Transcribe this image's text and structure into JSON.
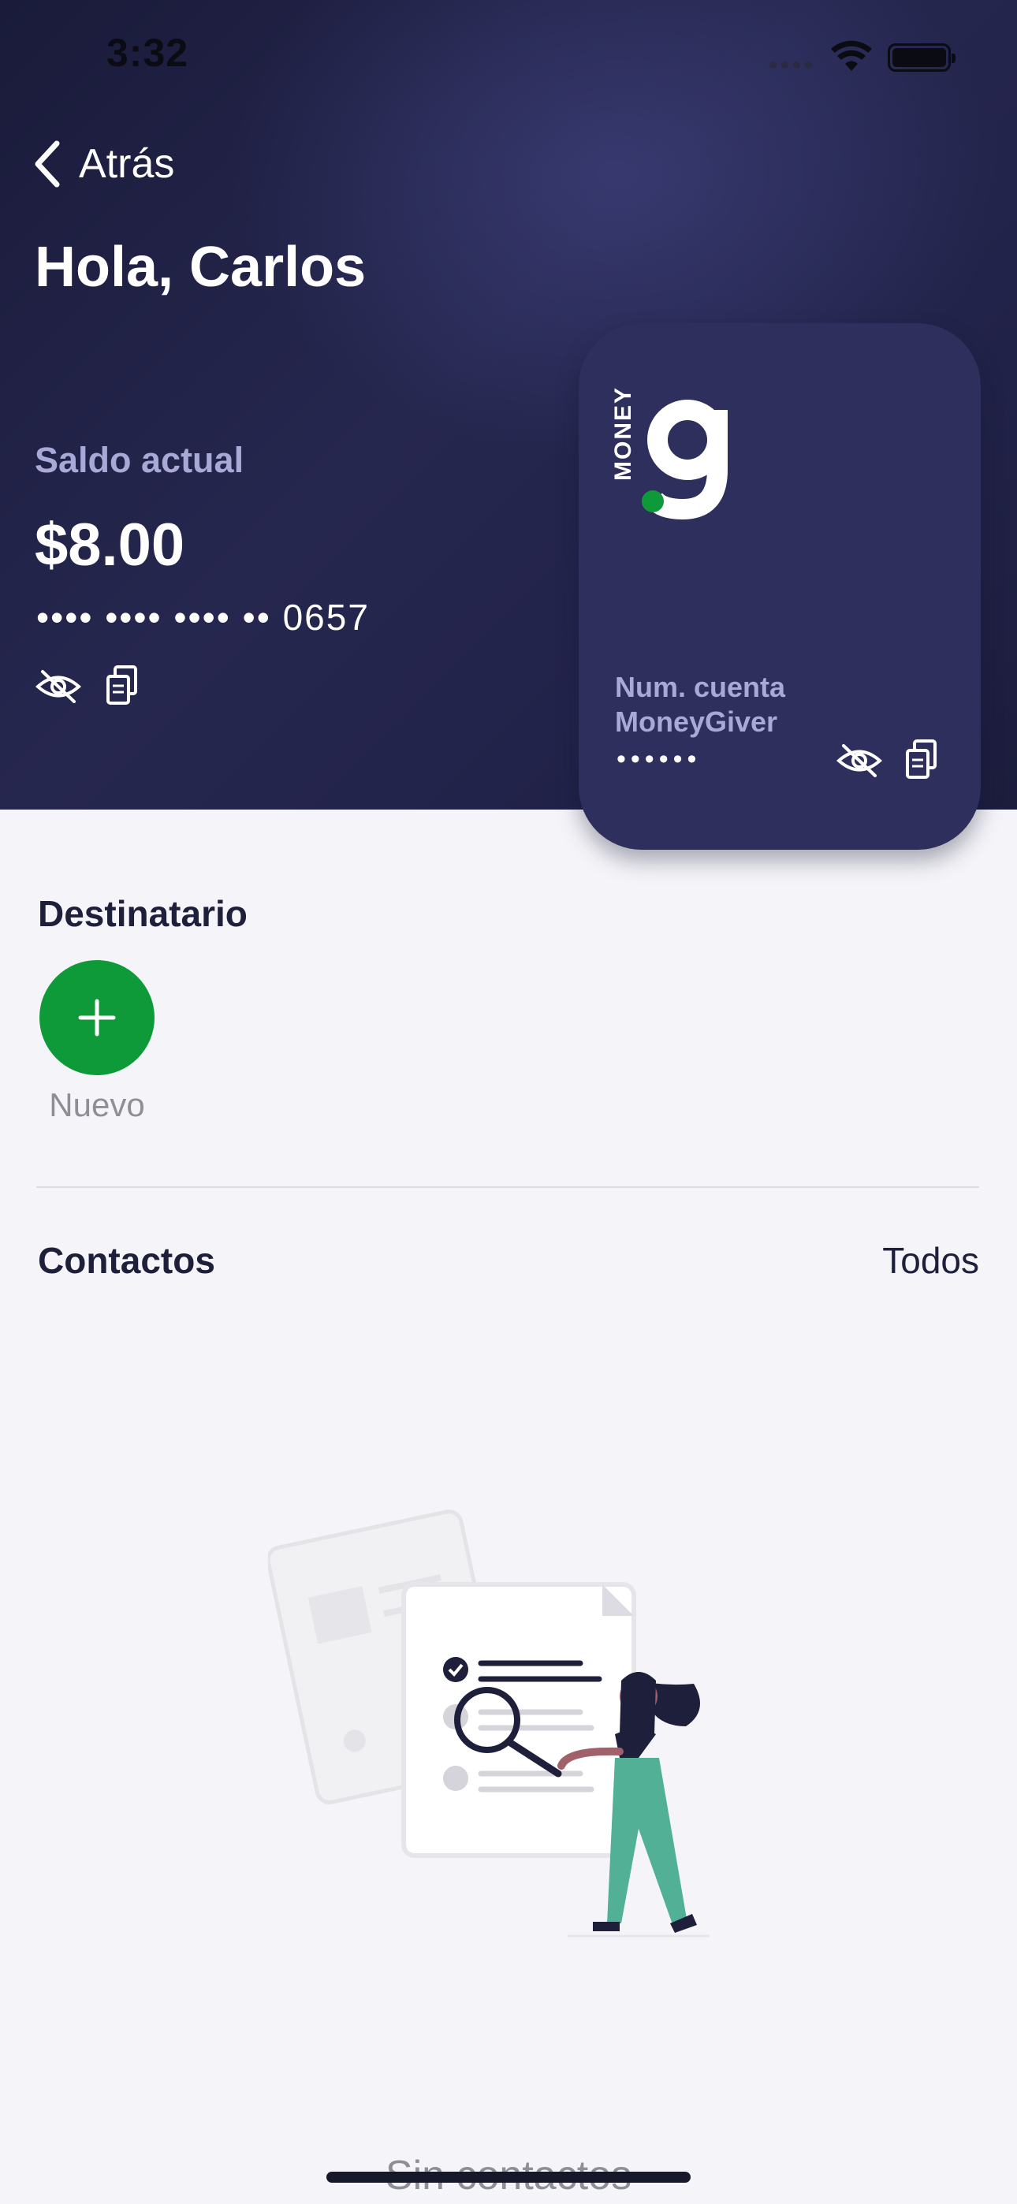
{
  "status_bar": {
    "time": "3:32"
  },
  "nav": {
    "back_label": "Atrás"
  },
  "header": {
    "greeting": "Hola, Carlos",
    "balance_label": "Saldo actual",
    "balance_value": "$8.00",
    "masked_account": "•••• •••• •••• •• 0657"
  },
  "card": {
    "brand_word": "MONEY",
    "brand_letter": "g",
    "label_line1": "Num. cuenta",
    "label_line2": "MoneyGiver",
    "masked_value": "••••••"
  },
  "recipients": {
    "title": "Destinatario",
    "new_label": "Nuevo"
  },
  "contacts": {
    "title": "Contactos",
    "see_all": "Todos",
    "empty_text": "Sin contactos"
  },
  "colors": {
    "header_dark": "#1a1b3a",
    "card": "#2e2f5c",
    "accent_green": "#0f9a3a",
    "muted_label": "#a8a9d6",
    "background": "#f5f5f9"
  },
  "icons": [
    "chevron-left-icon",
    "eye-off-icon",
    "copy-icon",
    "plus-icon",
    "wifi-icon",
    "battery-icon"
  ]
}
